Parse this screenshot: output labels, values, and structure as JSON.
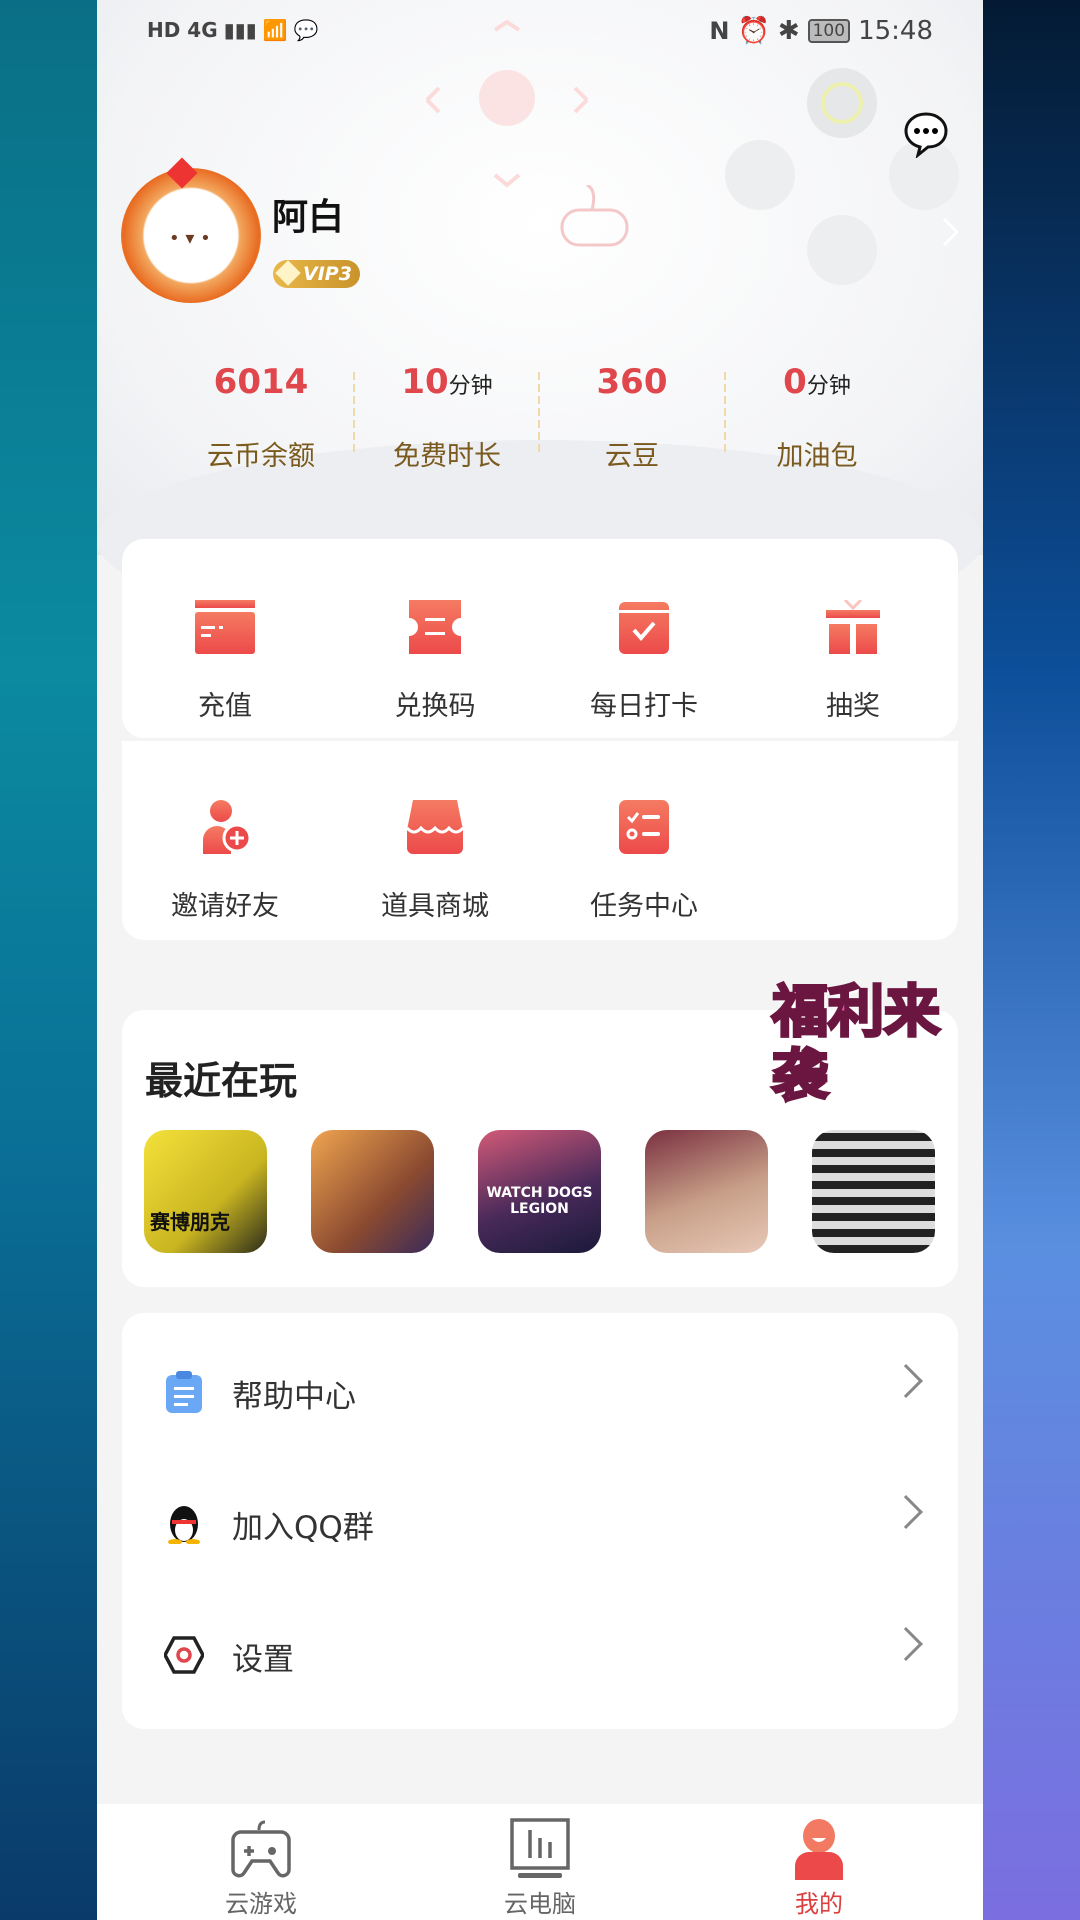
{
  "status_bar": {
    "left": "HD 4G",
    "time": "15:48",
    "battery": "100"
  },
  "profile": {
    "name": "阿白",
    "vip": "VIP3"
  },
  "stats": [
    {
      "value": "6014",
      "unit": "",
      "label": "云币余额"
    },
    {
      "value": "10",
      "unit": "分钟",
      "label": "免费时长"
    },
    {
      "value": "360",
      "unit": "",
      "label": "云豆"
    },
    {
      "value": "0",
      "unit": "分钟",
      "label": "加油包"
    }
  ],
  "grid": [
    {
      "label": "充值",
      "icon": "card-icon"
    },
    {
      "label": "兑换码",
      "icon": "ticket-icon"
    },
    {
      "label": "每日打卡",
      "icon": "calendar-check-icon"
    },
    {
      "label": "抽奖",
      "icon": "gift-icon"
    },
    {
      "label": "邀请好友",
      "icon": "add-user-icon"
    },
    {
      "label": "道具商城",
      "icon": "shop-icon"
    },
    {
      "label": "任务中心",
      "icon": "task-list-icon"
    }
  ],
  "recent": {
    "title": "最近在玩",
    "promo": "福利来袭",
    "games": [
      "赛博朋克",
      "GTA",
      "WATCH DOGS LEGION",
      "anime-girl",
      "anime-group"
    ]
  },
  "menu": [
    {
      "label": "帮助中心",
      "icon": "clipboard-icon"
    },
    {
      "label": "加入QQ群",
      "icon": "qq-penguin-icon"
    },
    {
      "label": "设置",
      "icon": "settings-hexagon-icon"
    }
  ],
  "nav": [
    {
      "label": "云游戏",
      "icon": "gamepad-icon",
      "active": false
    },
    {
      "label": "云电脑",
      "icon": "monitor-icon",
      "active": false
    },
    {
      "label": "我的",
      "icon": "person-icon",
      "active": true
    }
  ],
  "colors": {
    "accent": "#e0474c",
    "gold": "#7a5a1e"
  }
}
